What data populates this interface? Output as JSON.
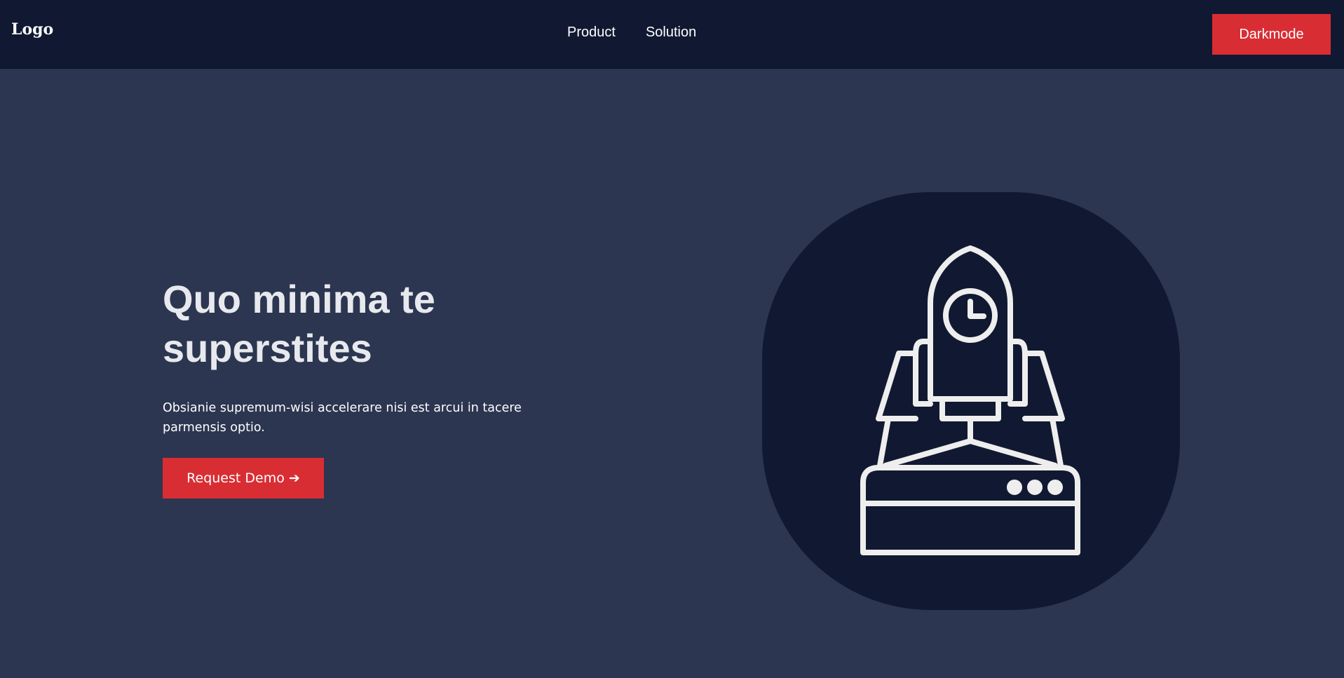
{
  "navbar": {
    "logo": "Logo",
    "links": [
      {
        "label": "Product"
      },
      {
        "label": "Solution"
      }
    ],
    "darkmode_label": "Darkmode"
  },
  "hero": {
    "title": "Quo minima te superstites",
    "text": "Obsianie supremum-wisi accelerare nisi est arcui in tacere parmensis optio.",
    "cta_label": "Request Demo ➔",
    "illustration_icon": "rocket-launch-icon"
  },
  "colors": {
    "navbar_bg": "#111932",
    "page_bg": "#2c3650",
    "accent": "#d92d34",
    "illustration_bg": "#111932",
    "icon_stroke": "#eeeeee"
  }
}
